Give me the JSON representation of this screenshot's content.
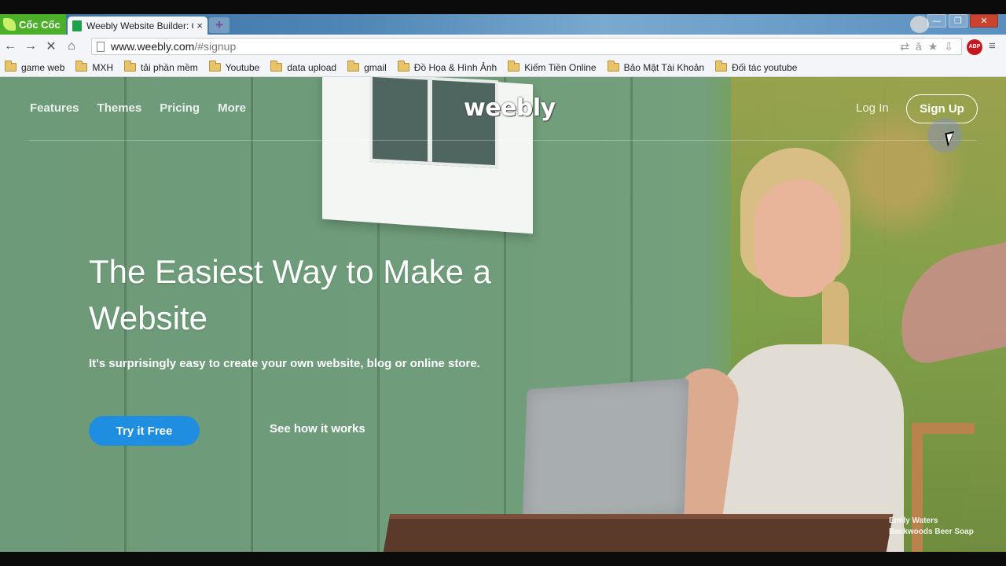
{
  "browser": {
    "brand_label": "Cốc Cốc",
    "tab_title": "Weebly Website Builder: C",
    "tab_close": "×",
    "new_tab": "+",
    "url_host": "www.weebly.com",
    "url_path": "/#signup",
    "abp_label": "ABP",
    "back_icon": "←",
    "forward_icon": "→",
    "reload_icon": "✕",
    "home_icon": "⌂",
    "menu_icon": "≡",
    "translate_icon": "⇄",
    "mic_icon": "ǎ",
    "star_icon": "★",
    "download_icon": "⇩",
    "minimize": "—",
    "maximize": "❐",
    "close": "✕"
  },
  "bookmarks": [
    "game web",
    "MXH",
    "tải phần mềm",
    "Youtube",
    "data upload",
    "gmail",
    "Đồ Họa & Hình Ảnh",
    "Kiếm Tiền Online",
    "Bảo Mật Tài Khoản",
    "Đối tác youtube"
  ],
  "site": {
    "nav": [
      "Features",
      "Themes",
      "Pricing",
      "More"
    ],
    "logo": "weebly",
    "login": "Log In",
    "signup": "Sign Up",
    "headline": "The Easiest Way to Make a Website",
    "subline": "It's surprisingly easy to create your own website, blog or online store.",
    "cta": "Try it Free",
    "secondary": "See how it works",
    "credit_name": "Emily Waters",
    "credit_business": "Backwoods Beer Soap"
  },
  "colors": {
    "cta_blue": "#1f8de0",
    "brand_green": "#4caf2a"
  }
}
